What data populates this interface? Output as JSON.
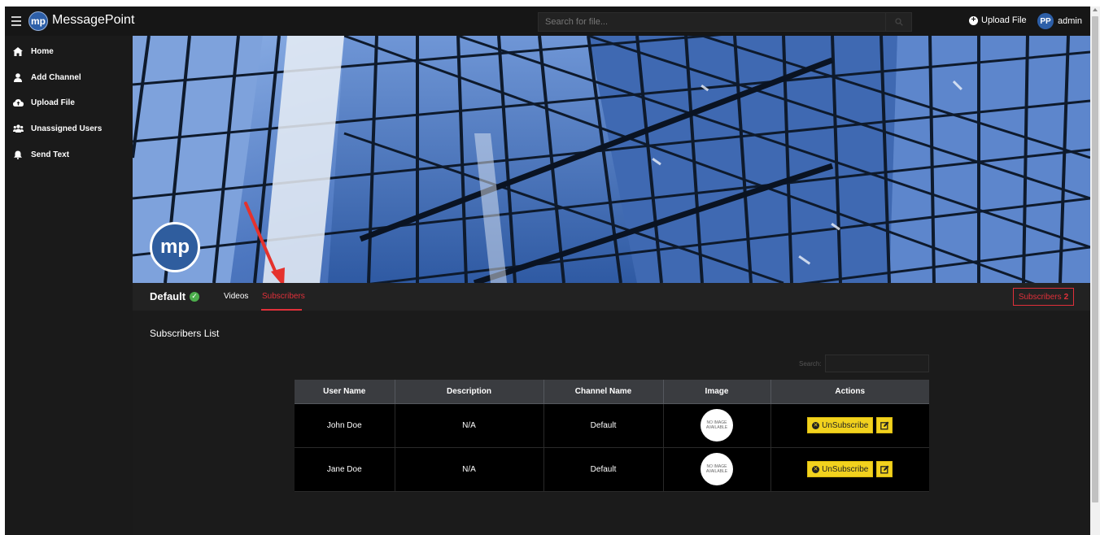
{
  "topbar": {
    "logo_text": "mp",
    "brand": "MessagePoint",
    "search_placeholder": "Search for file...",
    "upload_label": "Upload File",
    "user_initials": "PP",
    "user_name": "admin"
  },
  "sidebar": {
    "items": [
      {
        "label": "Home",
        "icon": "home-icon"
      },
      {
        "label": "Add Channel",
        "icon": "user-icon"
      },
      {
        "label": "Upload File",
        "icon": "cloud-upload-icon"
      },
      {
        "label": "Unassigned Users",
        "icon": "users-icon"
      },
      {
        "label": "Send Text",
        "icon": "bell-icon"
      }
    ]
  },
  "channel": {
    "logo_text": "mp",
    "name": "Default",
    "tabs": [
      "Videos",
      "Subscribers"
    ],
    "active_tab": "Subscribers",
    "subscribers_label": "Subscribers",
    "subscribers_count": "2"
  },
  "subscribers": {
    "title": "Subscribers List",
    "search_label": "Search:",
    "columns": [
      "User Name",
      "Description",
      "Channel Name",
      "Image",
      "Actions"
    ],
    "rows": [
      {
        "user": "John Doe",
        "description": "N/A",
        "channel": "Default",
        "image": "NO IMAGE AVAILABLE",
        "action": "UnSubscribe"
      },
      {
        "user": "Jane Doe",
        "description": "N/A",
        "channel": "Default",
        "image": "NO IMAGE AVAILABLE",
        "action": "UnSubscribe"
      }
    ]
  },
  "colors": {
    "accent_red": "#e0303a",
    "button_yellow": "#f2d21e",
    "brand_blue": "#2d5fa8",
    "verified_green": "#4cae4c"
  }
}
